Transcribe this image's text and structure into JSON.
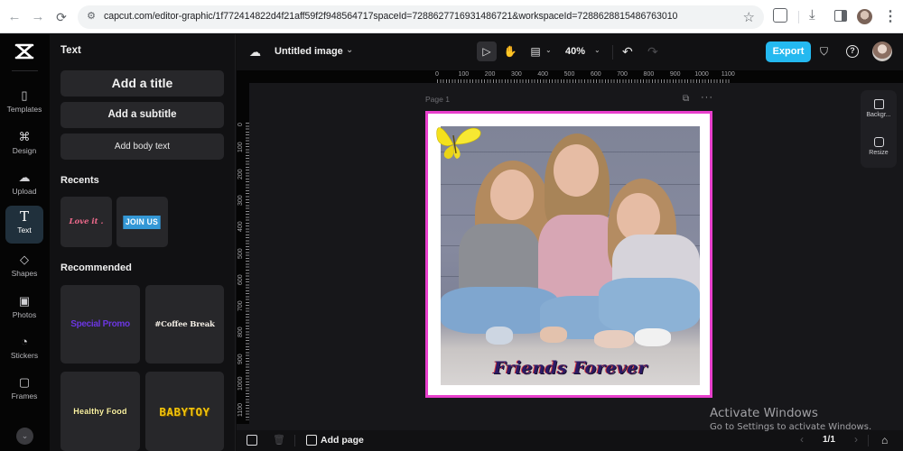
{
  "browser": {
    "url": "capcut.com/editor-graphic/1f772414822d4f21aff59f2f948564717spaceId=7288627716931486721&workspaceId=7288628815486763010",
    "nav": {
      "back": "←",
      "forward": "→",
      "reload": "C"
    }
  },
  "rail": {
    "items": [
      {
        "label": "Templates",
        "icon": "templates-icon"
      },
      {
        "label": "Design",
        "icon": "design-icon"
      },
      {
        "label": "Upload",
        "icon": "upload-cloud-icon"
      },
      {
        "label": "Text",
        "icon": "text-icon",
        "active": true
      },
      {
        "label": "Shapes",
        "icon": "shapes-icon"
      },
      {
        "label": "Photos",
        "icon": "photos-icon"
      },
      {
        "label": "Stickers",
        "icon": "stickers-icon"
      },
      {
        "label": "Frames",
        "icon": "frames-icon"
      }
    ],
    "glyphs": {
      "templates": "▯",
      "design": "⌘",
      "upload": "☁",
      "text": "T",
      "shapes": "◇",
      "photos": "▣",
      "stickers": "◔",
      "frames": "▢",
      "more": "⌄"
    }
  },
  "panel": {
    "title": "Text",
    "add_title": "Add a title",
    "add_subtitle": "Add a subtitle",
    "add_body": "Add body text",
    "recents_heading": "Recents",
    "recents": [
      "Love it .",
      "JOIN US"
    ],
    "recommended_heading": "Recommended",
    "recommended": [
      "Special Promo",
      "#Coffee Break",
      "Healthy Food",
      "BABYTOY"
    ]
  },
  "toolbar": {
    "doc_title": "Untitled image",
    "zoom": "40%",
    "export_label": "Export",
    "caret": "⌄",
    "glyphs": {
      "cloud": "☁",
      "select": "▷",
      "hand": "✋",
      "layout": "▤",
      "undo": "↶",
      "redo": "↷",
      "shield": "⛉",
      "help": "?"
    }
  },
  "rulers": {
    "horizontal": [
      "0",
      "100",
      "200",
      "300",
      "400",
      "500",
      "600",
      "700",
      "800",
      "900",
      "1000",
      "1100"
    ],
    "vertical": [
      "0",
      "100",
      "200",
      "300",
      "400",
      "500",
      "600",
      "700",
      "800",
      "900",
      "1000",
      "1100"
    ]
  },
  "canvas": {
    "page_label": "Page 1",
    "page_more": "···",
    "page_copy": "⧉",
    "caption": "Friends Forever",
    "frame_color": "#e83fcc"
  },
  "side_tools": {
    "background_label": "Backgr...",
    "resize_label": "Resize"
  },
  "bottom": {
    "add_page": "Add page",
    "page_count": "1/1",
    "prev": "‹",
    "next": "›",
    "trash": "🗑",
    "lock": "⌂"
  },
  "watermark": {
    "line1": "Activate Windows",
    "line2": "Go to Settings to activate Windows."
  },
  "colors": {
    "accent": "#24b9f0",
    "frame": "#e83fcc",
    "background": "#17171a"
  }
}
